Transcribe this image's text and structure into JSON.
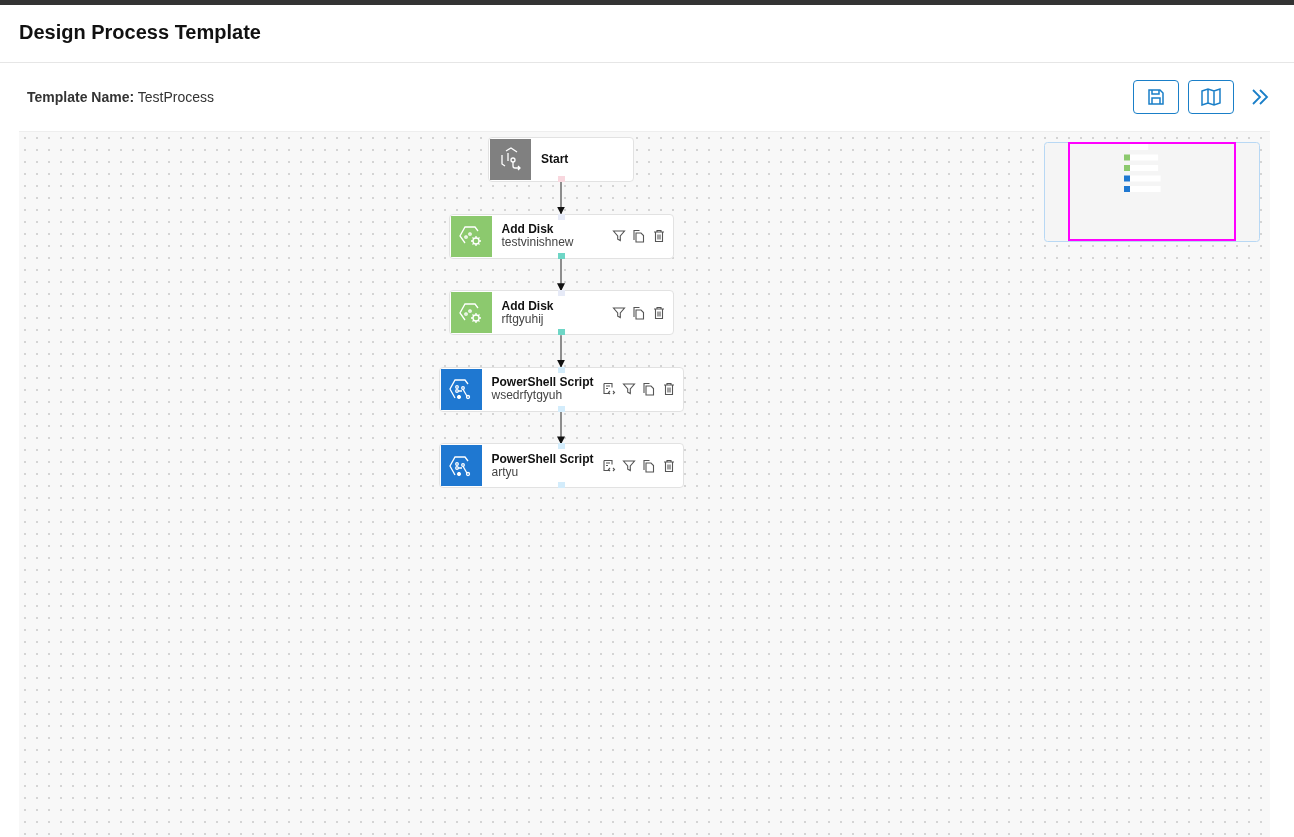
{
  "header": {
    "title": "Design Process Template"
  },
  "toolbar": {
    "label": "Template Name:",
    "value": "TestProcess"
  },
  "nodes": [
    {
      "kind": "start",
      "title": "Start",
      "color": "#808080"
    },
    {
      "kind": "disk",
      "title": "Add Disk",
      "subtitle": "testvinishnew",
      "color": "#8cc96e"
    },
    {
      "kind": "disk",
      "title": "Add Disk",
      "subtitle": "rftgyuhij",
      "color": "#8cc96e"
    },
    {
      "kind": "script",
      "title": "PowerShell Script",
      "subtitle": "wsedrfytgyuh",
      "color": "#1f78d1"
    },
    {
      "kind": "script",
      "title": "PowerShell Script",
      "subtitle": "artyu",
      "color": "#1f78d1"
    }
  ]
}
